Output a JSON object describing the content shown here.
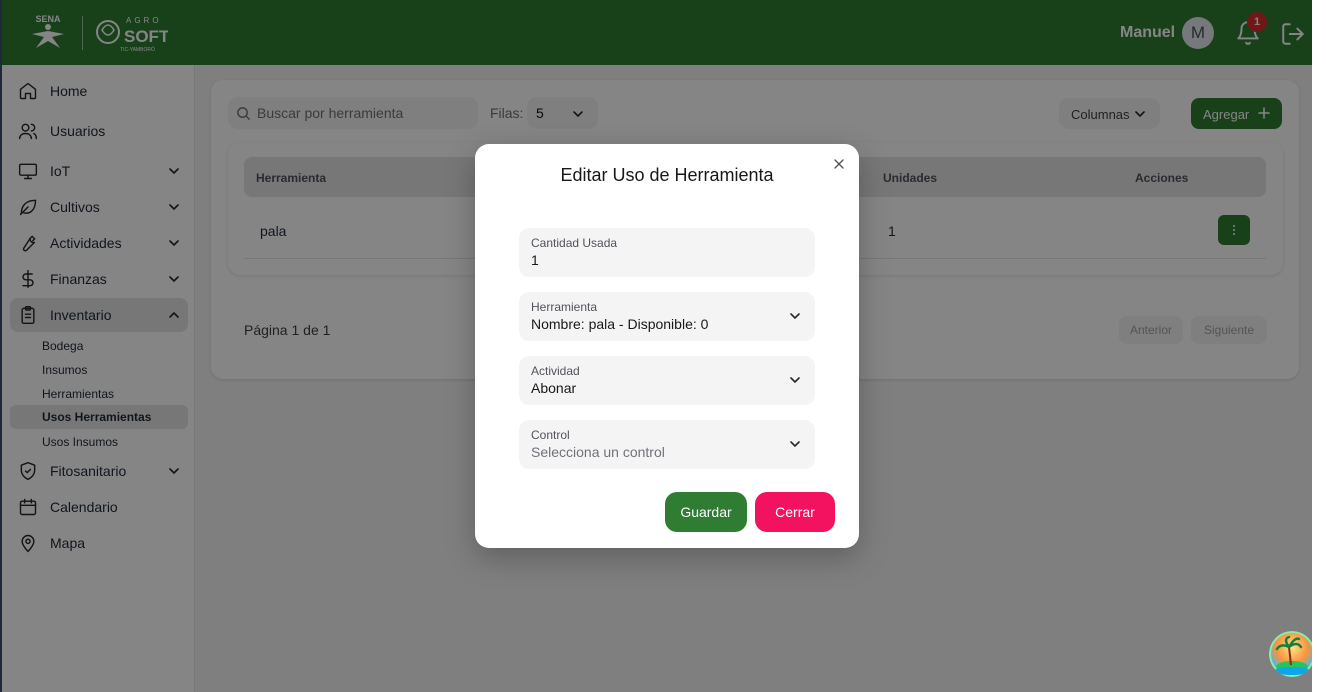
{
  "header": {
    "logo_left": "SENA",
    "logo_right_top": "AGRO",
    "logo_right_main": "SOFT",
    "logo_right_sub": "TIC-YAMBORÓ",
    "user_name": "Manuel",
    "avatar_initial": "M",
    "notification_count": "1",
    "brand_color": "#2e7d32"
  },
  "sidebar": {
    "items": [
      {
        "label": "Home",
        "icon": "home-icon"
      },
      {
        "label": "Usuarios",
        "icon": "users-icon"
      },
      {
        "label": "IoT",
        "icon": "monitor-icon"
      },
      {
        "label": "Cultivos",
        "icon": "leaf-icon"
      },
      {
        "label": "Actividades",
        "icon": "wrench-icon"
      },
      {
        "label": "Finanzas",
        "icon": "dollar-icon"
      },
      {
        "label": "Inventario",
        "icon": "clipboard-icon"
      },
      {
        "label": "Fitosanitario",
        "icon": "shield-icon"
      },
      {
        "label": "Calendario",
        "icon": "calendar-icon"
      },
      {
        "label": "Mapa",
        "icon": "map-pin-icon"
      }
    ],
    "inventario_subitems": [
      "Bodega",
      "Insumos",
      "Herramientas",
      "Usos Herramientas",
      "Usos Insumos"
    ]
  },
  "toolbar": {
    "search_placeholder": "Buscar por herramienta",
    "rows_label": "Filas:",
    "rows_value": "5",
    "columns_label": "Columnas",
    "add_label": "Agregar"
  },
  "table": {
    "headers": {
      "tool": "Herramienta",
      "units": "Unidades",
      "actions": "Acciones"
    },
    "rows": [
      {
        "tool": "pala",
        "units": "1"
      }
    ]
  },
  "pagination": {
    "text": "Página 1 de 1",
    "prev": "Anterior",
    "next": "Siguiente"
  },
  "modal": {
    "title": "Editar Uso de Herramienta",
    "fields": [
      {
        "label": "Cantidad Usada",
        "value": "1"
      },
      {
        "label": "Herramienta",
        "value": "Nombre: pala - Disponible: 0"
      },
      {
        "label": "Actividad",
        "value": "Abonar"
      },
      {
        "label": "Control",
        "placeholder": "Selecciona un control"
      }
    ],
    "save_label": "Guardar",
    "close_label": "Cerrar",
    "save_color": "#2e7d32",
    "close_color": "#f31260"
  }
}
